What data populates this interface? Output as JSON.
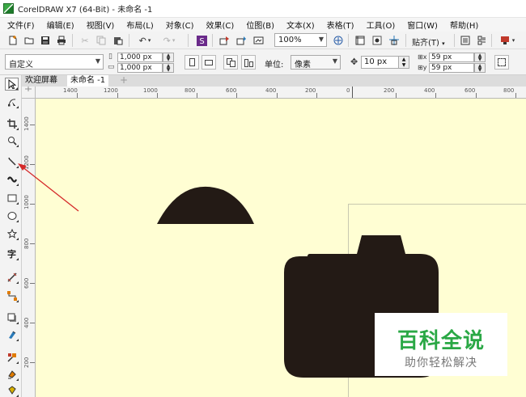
{
  "window": {
    "title": "CorelDRAW X7 (64-Bit) - 未命名 -1"
  },
  "menu": {
    "items": [
      "文件(F)",
      "编辑(E)",
      "视图(V)",
      "布局(L)",
      "对象(C)",
      "效果(C)",
      "位图(B)",
      "文本(X)",
      "表格(T)",
      "工具(O)",
      "窗口(W)",
      "帮助(H)"
    ]
  },
  "standard_toolbar": {
    "zoom_value": "100%",
    "snap_label": "贴齐(T)"
  },
  "property_bar": {
    "page_preset": "自定义",
    "page_width": "1,000 px",
    "page_height": "1,000 px",
    "units_label": "单位:",
    "units_value": "像素",
    "nudge_value": "10 px",
    "duplicate_x": "59 px",
    "duplicate_y": "59 px"
  },
  "document_tabs": {
    "welcome": "欢迎屏幕",
    "document": "未命名 -1",
    "add_symbol": "+"
  },
  "rulers": {
    "horizontal_labels": [
      "1400",
      "1200",
      "1000",
      "800",
      "600",
      "400",
      "200",
      "0",
      "200",
      "400",
      "600",
      "800"
    ],
    "vertical_labels": [
      "1400",
      "1200",
      "1000",
      "800",
      "600",
      "400",
      "200"
    ]
  },
  "toolbox": {
    "tools": [
      "pick-tool",
      "shape-tool",
      "crop-tool",
      "zoom-tool",
      "freehand-tool",
      "artistic-media-tool",
      "rectangle-tool",
      "ellipse-tool",
      "polygon-tool",
      "text-tool",
      "parallel-dimension-tool",
      "straight-line-connector-tool",
      "drop-shadow-tool",
      "transparency-tool",
      "color-eyedropper-tool",
      "interactive-fill-tool",
      "smart-fill-tool"
    ],
    "selected_tool": "pick-tool"
  },
  "artwork": {
    "fill_color": "#231a15",
    "canvas_color": "#fffed3",
    "arrow_color": "#d52a2a"
  },
  "watermark": {
    "title": "百科全说",
    "subtitle": "助你轻松解决",
    "title_color": "#2aa845"
  }
}
